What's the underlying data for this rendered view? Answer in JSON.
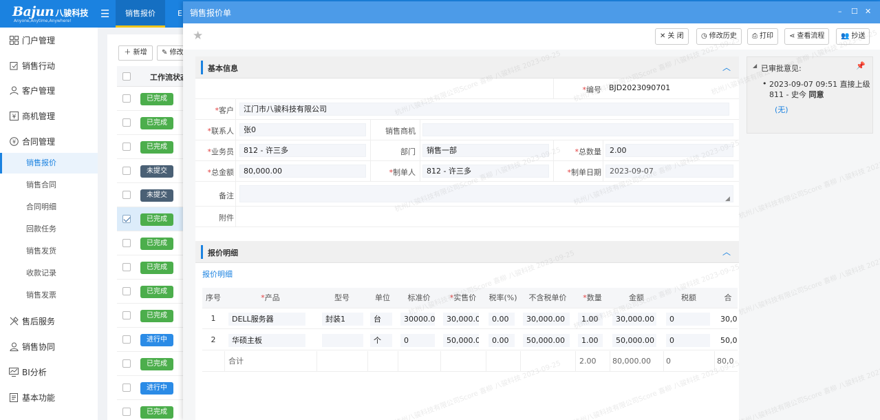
{
  "header": {
    "logo_text": "Bajun",
    "logo_cn": "八骏科技",
    "logo_sub": "Anyone,Anytime,Anywhere!",
    "tabs": [
      {
        "label": "销售报价"
      },
      {
        "label": "E"
      }
    ]
  },
  "sidebar": {
    "items": [
      {
        "label": "门户管理",
        "icon": "grid-icon"
      },
      {
        "label": "销售行动",
        "icon": "clipboard-icon"
      },
      {
        "label": "客户管理",
        "icon": "person-icon"
      },
      {
        "label": "商机管理",
        "icon": "opportunity-icon"
      },
      {
        "label": "合同管理",
        "icon": "contract-icon"
      },
      {
        "label": "售后服务",
        "icon": "tools-icon"
      },
      {
        "label": "销售协同",
        "icon": "user-icon"
      },
      {
        "label": "BI分析",
        "icon": "chart-icon"
      },
      {
        "label": "基本功能",
        "icon": "doc-icon"
      }
    ],
    "sub_items": [
      {
        "label": "销售报价",
        "active": true
      },
      {
        "label": "销售合同"
      },
      {
        "label": "合同明细"
      },
      {
        "label": "回款任务"
      },
      {
        "label": "销售发货"
      },
      {
        "label": "收款记录"
      },
      {
        "label": "销售发票"
      }
    ]
  },
  "list": {
    "add_label": "新增",
    "edit_label": "修改",
    "header_label": "工作流状态",
    "rows": [
      {
        "status": "已完成",
        "type": "done"
      },
      {
        "status": "已完成",
        "type": "done"
      },
      {
        "status": "已完成",
        "type": "done"
      },
      {
        "status": "未提交",
        "type": "none"
      },
      {
        "status": "未提交",
        "type": "none"
      },
      {
        "status": "已完成",
        "type": "done",
        "selected": true
      },
      {
        "status": "已完成",
        "type": "done"
      },
      {
        "status": "已完成",
        "type": "done"
      },
      {
        "status": "已完成",
        "type": "done"
      },
      {
        "status": "已完成",
        "type": "done"
      },
      {
        "status": "进行中",
        "type": "prog"
      },
      {
        "status": "已完成",
        "type": "done"
      },
      {
        "status": "进行中",
        "type": "prog"
      },
      {
        "status": "已完成",
        "type": "done"
      }
    ]
  },
  "modal": {
    "title": "销售报价单",
    "window_controls": {
      "minimize": "–",
      "maximize": "☐",
      "close": "✕"
    },
    "toolbar": {
      "close": "关 闭",
      "history": "修改历史",
      "print": "打印",
      "flow": "查看流程",
      "cc": "抄送"
    },
    "basic_section_title": "基本信息",
    "fields": {
      "number_label": "编号",
      "number_value": "BJD2023090701",
      "customer_label": "客户",
      "customer_value": "江门市八骏科技有限公司",
      "contact_label": "联系人",
      "contact_value": "张0",
      "opportunity_label": "销售商机",
      "opportunity_value": "",
      "salesman_label": "业务员",
      "salesman_value": "812 - 许三多",
      "dept_label": "部门",
      "dept_value": "销售一部",
      "qty_label": "总数量",
      "qty_value": "2.00",
      "amount_label": "总金额",
      "amount_value": "80,000.00",
      "creator_label": "制单人",
      "creator_value": "812 - 许三多",
      "date_label": "制单日期",
      "date_value": "2023-09-07",
      "remark_label": "备注",
      "remark_value": "",
      "attach_label": "附件"
    },
    "detail_section_title": "报价明细",
    "detail_link": "报价明细",
    "grid": {
      "headers": [
        "序号",
        "产品",
        "型号",
        "单位",
        "标准价",
        "实售价",
        "税率(%)",
        "不含税单价",
        "数量",
        "金额",
        "税额",
        "合"
      ],
      "rows": [
        {
          "no": "1",
          "product": "DELL服务器",
          "model": "封装1",
          "unit": "台",
          "std_price": "30000.00",
          "price": "30,000.00",
          "tax_rate": "0.00",
          "net_price": "30,000.00",
          "qty": "1.00",
          "amount": "30,000.00",
          "tax": "0",
          "total": "30,0"
        },
        {
          "no": "2",
          "product": "华硕主板",
          "model": "",
          "unit": "个",
          "std_price": "0",
          "price": "50,000.00",
          "tax_rate": "0.00",
          "net_price": "50,000.00",
          "qty": "1.00",
          "amount": "50,000.00",
          "tax": "0",
          "total": "50,0"
        }
      ],
      "sum_label": "合计",
      "sum_qty": "2.00",
      "sum_amount": "80,000.00",
      "sum_tax": "0",
      "sum_total": "80,0"
    },
    "approval": {
      "title": "已审批意见:",
      "entry": "2023-09-07 09:51 直接上级 811 - 史今",
      "result": "同意",
      "note": "(无)"
    }
  },
  "watermark_text": "杭州八骏科技有限公司Score 喜柳 八骏科技 2023-09-25",
  "colors": {
    "header_blue": "#1b82e0",
    "modal_title_blue": "#4c9be8",
    "done_green": "#4cae4c",
    "unsubmitted": "#4a6075",
    "in_progress": "#2b8be6"
  }
}
